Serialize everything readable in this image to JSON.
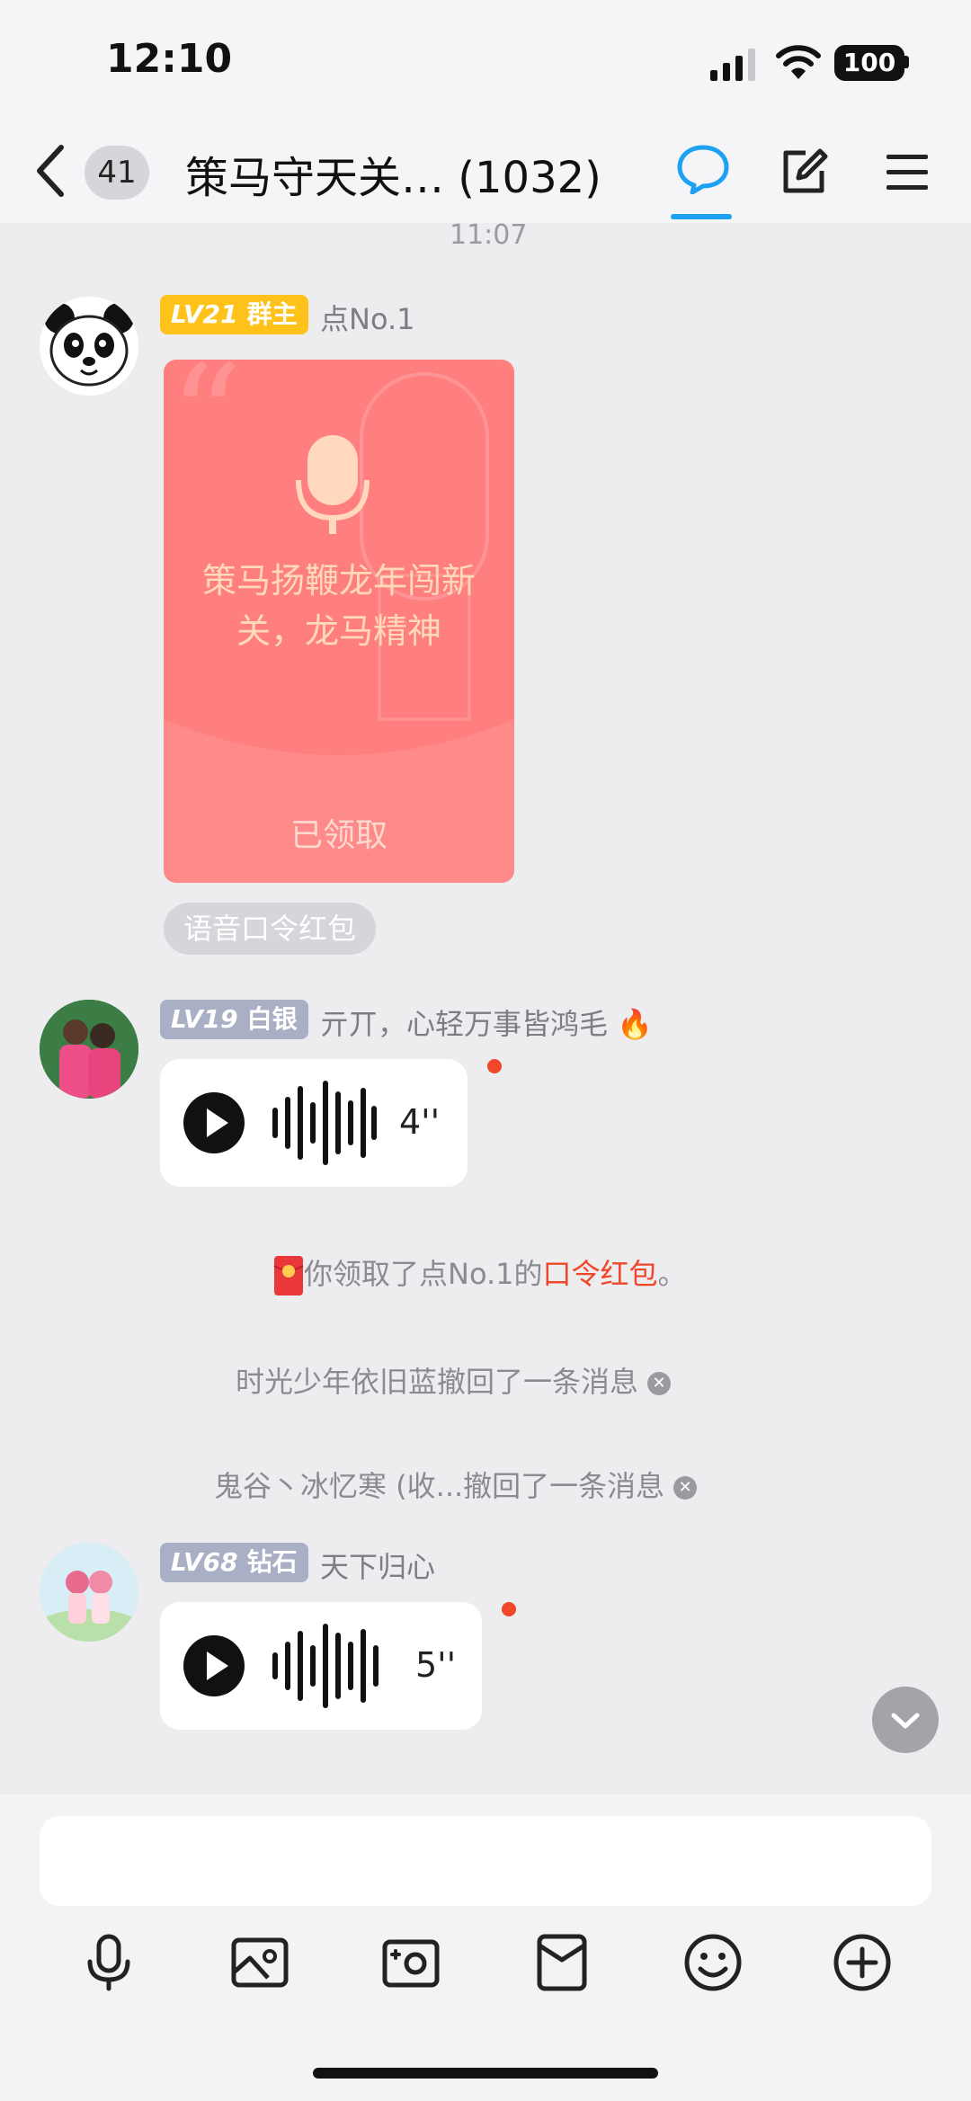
{
  "status_bar": {
    "time": "12:10",
    "battery": "100"
  },
  "header": {
    "unread_count": "41",
    "title": "策马守天关… (1032)"
  },
  "timestamp": "11:07",
  "messages": [
    {
      "badge_level": "LV21",
      "badge_role": "群主",
      "badge_color": "#ffc21a",
      "sender": "点No.1",
      "red_packet": {
        "text": "策马扬鞭龙年闯新关，龙马精神",
        "status": "已领取",
        "tag": "语音口令红包"
      }
    },
    {
      "badge_level": "LV19",
      "badge_role": "白银",
      "badge_color": "#a9afc4",
      "sender": "亓丌，心轻万事皆鸿毛 🔥",
      "voice_duration": "4''"
    },
    {
      "badge_level": "LV68",
      "badge_role": "钻石",
      "badge_color": "#a9afc4",
      "sender": "天下归心",
      "voice_duration": "5''"
    }
  ],
  "system_messages": {
    "claimed_prefix": "你领取了点No.1的",
    "claimed_link": "口令红包",
    "claimed_suffix": "。",
    "recall_1": "时光少年依旧蓝撤回了一条消息",
    "recall_2": "鬼谷丶冰忆寒 (收...撤回了一条消息"
  },
  "input": {
    "placeholder": ""
  },
  "toolbar": [
    "mic-icon",
    "image-icon",
    "camera-icon",
    "red-packet-icon",
    "emoji-icon",
    "plus-icon"
  ],
  "colors": {
    "accent": "#1da1f2",
    "red_packet": "#ff7f7f",
    "alert": "#f0462a"
  }
}
